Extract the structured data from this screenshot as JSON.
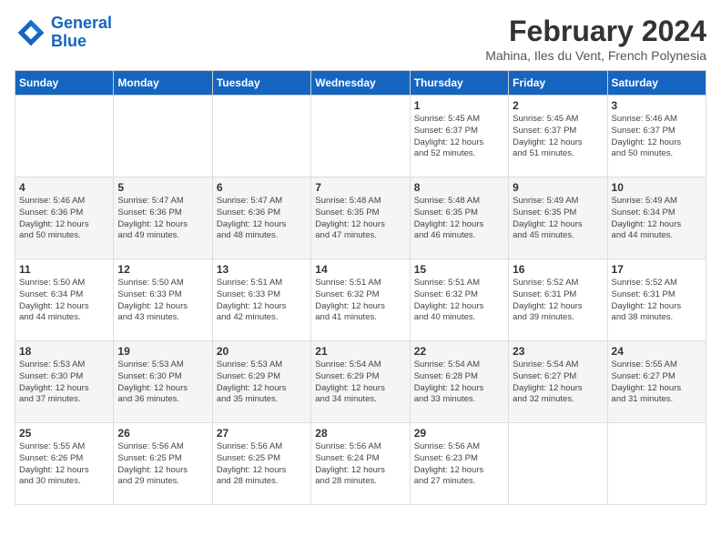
{
  "logo": {
    "line1": "General",
    "line2": "Blue"
  },
  "title": "February 2024",
  "subtitle": "Mahina, Iles du Vent, French Polynesia",
  "weekdays": [
    "Sunday",
    "Monday",
    "Tuesday",
    "Wednesday",
    "Thursday",
    "Friday",
    "Saturday"
  ],
  "weeks": [
    [
      {
        "day": "",
        "info": ""
      },
      {
        "day": "",
        "info": ""
      },
      {
        "day": "",
        "info": ""
      },
      {
        "day": "",
        "info": ""
      },
      {
        "day": "1",
        "info": "Sunrise: 5:45 AM\nSunset: 6:37 PM\nDaylight: 12 hours\nand 52 minutes."
      },
      {
        "day": "2",
        "info": "Sunrise: 5:45 AM\nSunset: 6:37 PM\nDaylight: 12 hours\nand 51 minutes."
      },
      {
        "day": "3",
        "info": "Sunrise: 5:46 AM\nSunset: 6:37 PM\nDaylight: 12 hours\nand 50 minutes."
      }
    ],
    [
      {
        "day": "4",
        "info": "Sunrise: 5:46 AM\nSunset: 6:36 PM\nDaylight: 12 hours\nand 50 minutes."
      },
      {
        "day": "5",
        "info": "Sunrise: 5:47 AM\nSunset: 6:36 PM\nDaylight: 12 hours\nand 49 minutes."
      },
      {
        "day": "6",
        "info": "Sunrise: 5:47 AM\nSunset: 6:36 PM\nDaylight: 12 hours\nand 48 minutes."
      },
      {
        "day": "7",
        "info": "Sunrise: 5:48 AM\nSunset: 6:35 PM\nDaylight: 12 hours\nand 47 minutes."
      },
      {
        "day": "8",
        "info": "Sunrise: 5:48 AM\nSunset: 6:35 PM\nDaylight: 12 hours\nand 46 minutes."
      },
      {
        "day": "9",
        "info": "Sunrise: 5:49 AM\nSunset: 6:35 PM\nDaylight: 12 hours\nand 45 minutes."
      },
      {
        "day": "10",
        "info": "Sunrise: 5:49 AM\nSunset: 6:34 PM\nDaylight: 12 hours\nand 44 minutes."
      }
    ],
    [
      {
        "day": "11",
        "info": "Sunrise: 5:50 AM\nSunset: 6:34 PM\nDaylight: 12 hours\nand 44 minutes."
      },
      {
        "day": "12",
        "info": "Sunrise: 5:50 AM\nSunset: 6:33 PM\nDaylight: 12 hours\nand 43 minutes."
      },
      {
        "day": "13",
        "info": "Sunrise: 5:51 AM\nSunset: 6:33 PM\nDaylight: 12 hours\nand 42 minutes."
      },
      {
        "day": "14",
        "info": "Sunrise: 5:51 AM\nSunset: 6:32 PM\nDaylight: 12 hours\nand 41 minutes."
      },
      {
        "day": "15",
        "info": "Sunrise: 5:51 AM\nSunset: 6:32 PM\nDaylight: 12 hours\nand 40 minutes."
      },
      {
        "day": "16",
        "info": "Sunrise: 5:52 AM\nSunset: 6:31 PM\nDaylight: 12 hours\nand 39 minutes."
      },
      {
        "day": "17",
        "info": "Sunrise: 5:52 AM\nSunset: 6:31 PM\nDaylight: 12 hours\nand 38 minutes."
      }
    ],
    [
      {
        "day": "18",
        "info": "Sunrise: 5:53 AM\nSunset: 6:30 PM\nDaylight: 12 hours\nand 37 minutes."
      },
      {
        "day": "19",
        "info": "Sunrise: 5:53 AM\nSunset: 6:30 PM\nDaylight: 12 hours\nand 36 minutes."
      },
      {
        "day": "20",
        "info": "Sunrise: 5:53 AM\nSunset: 6:29 PM\nDaylight: 12 hours\nand 35 minutes."
      },
      {
        "day": "21",
        "info": "Sunrise: 5:54 AM\nSunset: 6:29 PM\nDaylight: 12 hours\nand 34 minutes."
      },
      {
        "day": "22",
        "info": "Sunrise: 5:54 AM\nSunset: 6:28 PM\nDaylight: 12 hours\nand 33 minutes."
      },
      {
        "day": "23",
        "info": "Sunrise: 5:54 AM\nSunset: 6:27 PM\nDaylight: 12 hours\nand 32 minutes."
      },
      {
        "day": "24",
        "info": "Sunrise: 5:55 AM\nSunset: 6:27 PM\nDaylight: 12 hours\nand 31 minutes."
      }
    ],
    [
      {
        "day": "25",
        "info": "Sunrise: 5:55 AM\nSunset: 6:26 PM\nDaylight: 12 hours\nand 30 minutes."
      },
      {
        "day": "26",
        "info": "Sunrise: 5:56 AM\nSunset: 6:25 PM\nDaylight: 12 hours\nand 29 minutes."
      },
      {
        "day": "27",
        "info": "Sunrise: 5:56 AM\nSunset: 6:25 PM\nDaylight: 12 hours\nand 28 minutes."
      },
      {
        "day": "28",
        "info": "Sunrise: 5:56 AM\nSunset: 6:24 PM\nDaylight: 12 hours\nand 28 minutes."
      },
      {
        "day": "29",
        "info": "Sunrise: 5:56 AM\nSunset: 6:23 PM\nDaylight: 12 hours\nand 27 minutes."
      },
      {
        "day": "",
        "info": ""
      },
      {
        "day": "",
        "info": ""
      }
    ]
  ]
}
